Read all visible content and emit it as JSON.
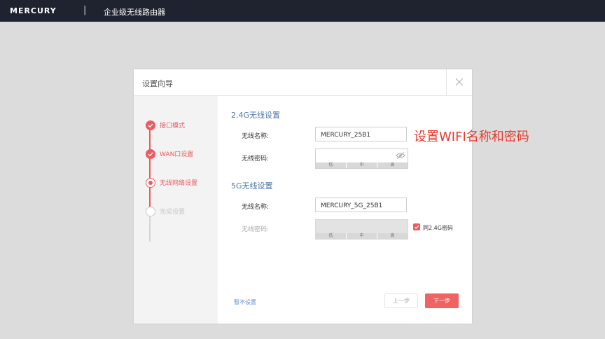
{
  "topbar": {
    "brand": "MERCURY",
    "separator": "|",
    "product_name": "企业级无线路由器"
  },
  "dialog": {
    "title": "设置向导",
    "close_icon": "close-icon",
    "steps": [
      {
        "label": "接口模式",
        "state": "done"
      },
      {
        "label": "WAN口设置",
        "state": "done"
      },
      {
        "label": "无线网络设置",
        "state": "active"
      },
      {
        "label": "完成设置",
        "state": "todo"
      }
    ],
    "band_24": {
      "title": "2.4G无线设置",
      "ssid_label": "无线名称:",
      "ssid_value": "MERCURY_25B1",
      "password_label": "无线密码:",
      "password_value": "",
      "strength": [
        "低",
        "中",
        "高"
      ]
    },
    "band_5": {
      "title": "5G无线设置",
      "ssid_label": "无线名称:",
      "ssid_value": "MERCURY_5G_25B1",
      "password_label": "无线密码:",
      "strength": [
        "低",
        "中",
        "高"
      ],
      "same_as_24_label": "同2.4G密码",
      "same_as_24_checked": true
    },
    "skip_label": "暂不设置",
    "prev_label": "上一步",
    "next_label": "下一步"
  },
  "annotation": "设置WIFI名称和密码",
  "colors": {
    "accent": "#ec5b5f",
    "topbar": "#1f2330",
    "section_title": "#4f74a8",
    "annotation": "#e53b2f"
  }
}
